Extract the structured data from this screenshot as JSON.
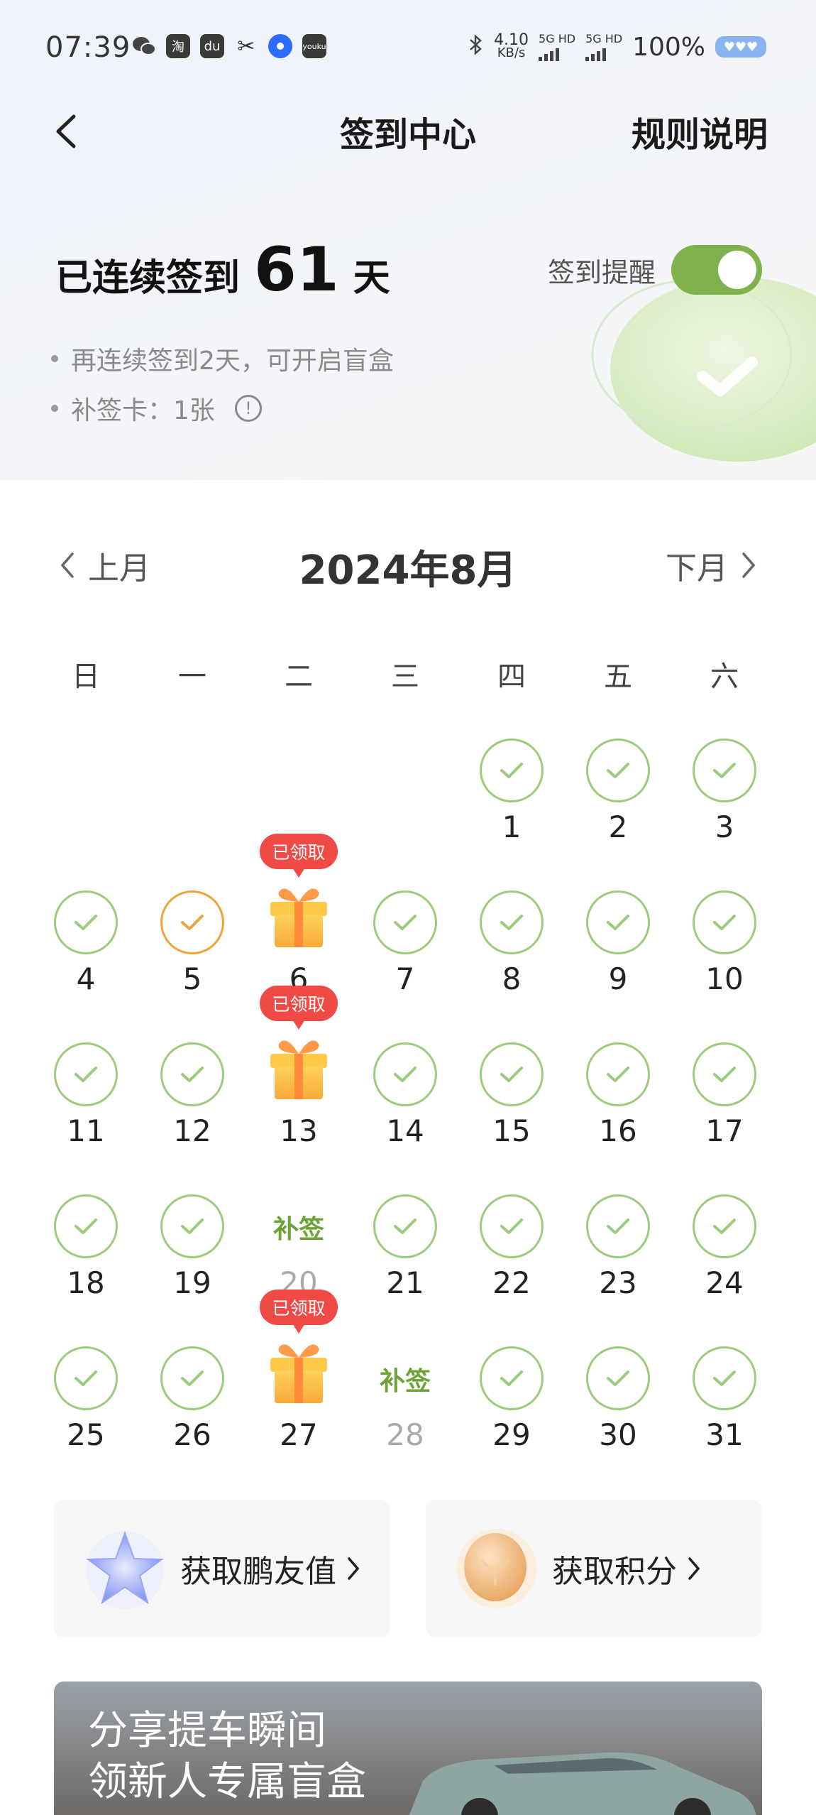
{
  "status_bar": {
    "time": "07:39",
    "app_icons": [
      "wechat-icon",
      "taobao-icon",
      "du-icon",
      "scissors-icon",
      "browser-icon",
      "youku-icon"
    ],
    "app_icon_glyphs": [
      "淘",
      "du",
      "youku"
    ],
    "network_speed": "4.10",
    "network_unit": "KB/s",
    "sim1": "5G HD",
    "sim2": "5G HD",
    "battery": "100%"
  },
  "nav": {
    "title": "签到中心",
    "rules": "规则说明"
  },
  "streak": {
    "label": "已连续签到",
    "days": "61",
    "unit": "天"
  },
  "reminder": {
    "label": "签到提醒",
    "enabled": true
  },
  "bullets": [
    "再连续签到2天，可开启盲盒",
    "补签卡：1张"
  ],
  "calendar": {
    "prev": "上月",
    "title": "2024年8月",
    "next": "下月",
    "weekdays": [
      "日",
      "一",
      "二",
      "三",
      "四",
      "五",
      "六"
    ],
    "gift_label": "已领取",
    "makeup_label": "补签",
    "weeks": [
      [
        null,
        null,
        null,
        null,
        {
          "day": "1",
          "state": "checked"
        },
        {
          "day": "2",
          "state": "checked"
        },
        {
          "day": "3",
          "state": "checked"
        }
      ],
      [
        {
          "day": "4",
          "state": "checked"
        },
        {
          "day": "5",
          "state": "today"
        },
        {
          "day": "6",
          "state": "gift"
        },
        {
          "day": "7",
          "state": "checked"
        },
        {
          "day": "8",
          "state": "checked"
        },
        {
          "day": "9",
          "state": "checked"
        },
        {
          "day": "10",
          "state": "checked"
        }
      ],
      [
        {
          "day": "11",
          "state": "checked"
        },
        {
          "day": "12",
          "state": "checked"
        },
        {
          "day": "13",
          "state": "gift"
        },
        {
          "day": "14",
          "state": "checked"
        },
        {
          "day": "15",
          "state": "checked"
        },
        {
          "day": "16",
          "state": "checked"
        },
        {
          "day": "17",
          "state": "checked"
        }
      ],
      [
        {
          "day": "18",
          "state": "checked"
        },
        {
          "day": "19",
          "state": "checked"
        },
        {
          "day": "20",
          "state": "makeup"
        },
        {
          "day": "21",
          "state": "checked"
        },
        {
          "day": "22",
          "state": "checked"
        },
        {
          "day": "23",
          "state": "checked"
        },
        {
          "day": "24",
          "state": "checked"
        }
      ],
      [
        {
          "day": "25",
          "state": "checked"
        },
        {
          "day": "26",
          "state": "checked"
        },
        {
          "day": "27",
          "state": "gift"
        },
        {
          "day": "28",
          "state": "makeup"
        },
        {
          "day": "29",
          "state": "checked"
        },
        {
          "day": "30",
          "state": "checked"
        },
        {
          "day": "31",
          "state": "checked"
        }
      ]
    ]
  },
  "cards": [
    {
      "label": "获取鹏友值",
      "icon": "star-icon"
    },
    {
      "label": "获取积分",
      "icon": "coin-icon"
    }
  ],
  "banner": {
    "line1": "分享提车瞬间",
    "line2": "领新人专属盲盒"
  },
  "colors": {
    "accent_green": "#7fb24d",
    "check_border": "#9ccb7d",
    "today_orange": "#f0a23d",
    "badge_red": "#f04a47"
  }
}
